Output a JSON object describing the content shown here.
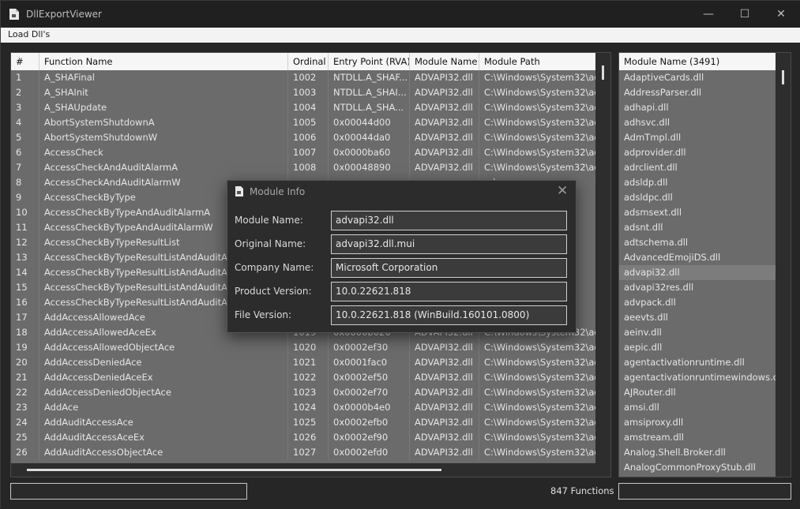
{
  "window": {
    "title": "DllExportViewer",
    "controls": {
      "minimize": "—",
      "maximize": "☐",
      "close": "✕"
    }
  },
  "menu": {
    "load": "Load Dll's"
  },
  "grid": {
    "columns": [
      "#",
      "Function Name",
      "Ordinal",
      "Entry Point (RVA)",
      "Module Name",
      "Module Path"
    ],
    "rows": [
      [
        "1",
        "A_SHAFinal",
        "1002",
        "NTDLL.A_SHAF...",
        "ADVAPI32.dll",
        "C:\\Windows\\System32\\adv"
      ],
      [
        "2",
        "A_SHAInit",
        "1003",
        "NTDLL.A_SHAI...",
        "ADVAPI32.dll",
        "C:\\Windows\\System32\\adv"
      ],
      [
        "3",
        "A_SHAUpdate",
        "1004",
        "NTDLL.A_SHA...",
        "ADVAPI32.dll",
        "C:\\Windows\\System32\\adv"
      ],
      [
        "4",
        "AbortSystemShutdownA",
        "1005",
        "0x00044d00",
        "ADVAPI32.dll",
        "C:\\Windows\\System32\\adv"
      ],
      [
        "5",
        "AbortSystemShutdownW",
        "1006",
        "0x00044da0",
        "ADVAPI32.dll",
        "C:\\Windows\\System32\\adv"
      ],
      [
        "6",
        "AccessCheck",
        "1007",
        "0x0000ba60",
        "ADVAPI32.dll",
        "C:\\Windows\\System32\\adv"
      ],
      [
        "7",
        "AccessCheckAndAuditAlarmA",
        "1008",
        "0x00048890",
        "ADVAPI32.dll",
        "C:\\Windows\\System32\\adv"
      ],
      [
        "8",
        "AccessCheckAndAuditAlarmW",
        "",
        "",
        "",
        "adv"
      ],
      [
        "9",
        "AccessCheckByType",
        "",
        "",
        "",
        "adv"
      ],
      [
        "10",
        "AccessCheckByTypeAndAuditAlarmA",
        "",
        "",
        "",
        "adv"
      ],
      [
        "11",
        "AccessCheckByTypeAndAuditAlarmW",
        "",
        "",
        "",
        "adv"
      ],
      [
        "12",
        "AccessCheckByTypeResultList",
        "",
        "",
        "",
        "adv"
      ],
      [
        "13",
        "AccessCheckByTypeResultListAndAuditAlarmA",
        "",
        "",
        "",
        "adv"
      ],
      [
        "14",
        "AccessCheckByTypeResultListAndAuditAlarmB",
        "",
        "",
        "",
        "adv"
      ],
      [
        "15",
        "AccessCheckByTypeResultListAndAuditAlarmW",
        "",
        "",
        "",
        "adv"
      ],
      [
        "16",
        "AccessCheckByTypeResultListAndAuditAlarmX",
        "",
        "",
        "",
        "adv"
      ],
      [
        "17",
        "AddAccessAllowedAce",
        "",
        "",
        "",
        "adv"
      ],
      [
        "18",
        "AddAccessAllowedAceEx",
        "1019",
        "0x0000b020",
        "ADVAPI32.dll",
        "C:\\Windows\\System32\\adv"
      ],
      [
        "19",
        "AddAccessAllowedObjectAce",
        "1020",
        "0x0002ef30",
        "ADVAPI32.dll",
        "C:\\Windows\\System32\\adv"
      ],
      [
        "20",
        "AddAccessDeniedAce",
        "1021",
        "0x0001fac0",
        "ADVAPI32.dll",
        "C:\\Windows\\System32\\adv"
      ],
      [
        "21",
        "AddAccessDeniedAceEx",
        "1022",
        "0x0002ef50",
        "ADVAPI32.dll",
        "C:\\Windows\\System32\\adv"
      ],
      [
        "22",
        "AddAccessDeniedObjectAce",
        "1023",
        "0x0002ef70",
        "ADVAPI32.dll",
        "C:\\Windows\\System32\\adv"
      ],
      [
        "23",
        "AddAce",
        "1024",
        "0x0000b4e0",
        "ADVAPI32.dll",
        "C:\\Windows\\System32\\adv"
      ],
      [
        "24",
        "AddAuditAccessAce",
        "1025",
        "0x0002efb0",
        "ADVAPI32.dll",
        "C:\\Windows\\System32\\adv"
      ],
      [
        "25",
        "AddAuditAccessAceEx",
        "1026",
        "0x0002ef90",
        "ADVAPI32.dll",
        "C:\\Windows\\System32\\adv"
      ],
      [
        "26",
        "AddAuditAccessObjectAce",
        "1027",
        "0x0002efd0",
        "ADVAPI32.dll",
        "C:\\Windows\\System32\\adv"
      ]
    ]
  },
  "modules": {
    "header": "Module Name (3491)",
    "selected": "advapi32.dll",
    "items": [
      "AdaptiveCards.dll",
      "AddressParser.dll",
      "adhapi.dll",
      "adhsvc.dll",
      "AdmTmpl.dll",
      "adprovider.dll",
      "adrclient.dll",
      "adsldp.dll",
      "adsldpc.dll",
      "adsmsext.dll",
      "adsnt.dll",
      "adtschema.dll",
      "AdvancedEmojiDS.dll",
      "advapi32.dll",
      "advapi32res.dll",
      "advpack.dll",
      "aeevts.dll",
      "aeinv.dll",
      "aepic.dll",
      "agentactivationruntime.dll",
      "agentactivationruntimewindows.dll",
      "AJRouter.dll",
      "amsi.dll",
      "amsiproxy.dll",
      "amstream.dll",
      "Analog.Shell.Broker.dll",
      "AnalogCommonProxyStub.dll"
    ]
  },
  "status": {
    "function_count": "847 Functions"
  },
  "dialog": {
    "title": "Module Info",
    "close": "✕",
    "fields": [
      {
        "label": "Module Name:",
        "value": "advapi32.dll"
      },
      {
        "label": "Original Name:",
        "value": "advapi32.dll.mui"
      },
      {
        "label": "Company Name:",
        "value": "Microsoft Corporation"
      },
      {
        "label": "Product Version:",
        "value": "10.0.22621.818"
      },
      {
        "label": "File Version:",
        "value": "10.0.22621.818 (WinBuild.160101.0800)"
      }
    ]
  }
}
